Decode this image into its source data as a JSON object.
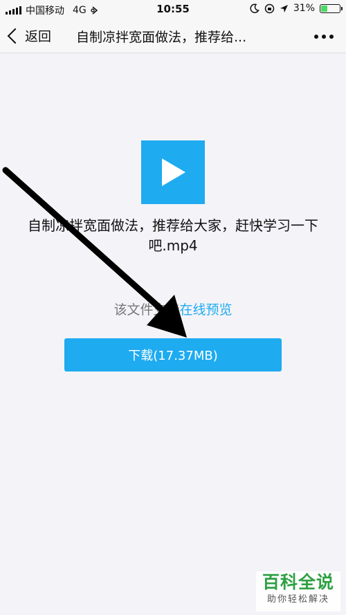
{
  "status_bar": {
    "carrier": "中国移动",
    "network": "4G",
    "time": "10:55",
    "battery_percent": "31%",
    "battery_level": 0.31
  },
  "nav": {
    "back_label": "返回",
    "title": "自制凉拌宽面做法，推荐给..."
  },
  "file": {
    "icon": "video-play-icon",
    "name": "自制凉拌宽面做法，推荐给大家，赶快学习一下吧.mp4"
  },
  "preview": {
    "prefix": "该文件支持",
    "link": "在线预览"
  },
  "download": {
    "label": "下载(17.37MB)"
  },
  "watermark": {
    "main": "百科全说",
    "sub": "助你轻松解决"
  },
  "colors": {
    "accent": "#1eabf0",
    "background": "#f4f3f8",
    "battery": "#4cd964",
    "watermark": "#2ea043"
  }
}
